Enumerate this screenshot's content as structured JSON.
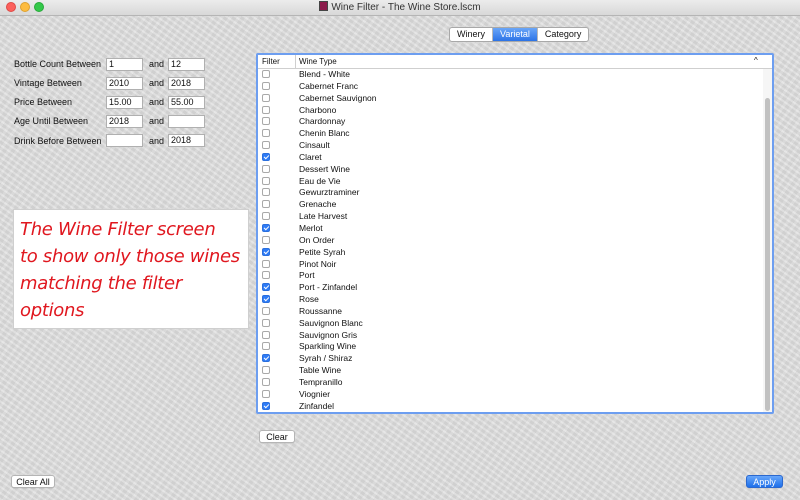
{
  "window": {
    "title": "Wine Filter - The Wine Store.lscm",
    "icons": {
      "close": "close-dot",
      "minimize": "minimize-dot",
      "zoom": "zoom-dot",
      "document": "document-icon"
    }
  },
  "tabs": [
    {
      "label": "Winery",
      "active": false
    },
    {
      "label": "Varietal",
      "active": true
    },
    {
      "label": "Category",
      "active": false
    }
  ],
  "filters": {
    "and_label": "and",
    "rows": [
      {
        "label": "Bottle Count Between",
        "from": "1",
        "to": "12"
      },
      {
        "label": "Vintage Between",
        "from": "2010",
        "to": "2018"
      },
      {
        "label": "Price Between",
        "from": "15.00",
        "to": "55.00"
      },
      {
        "label": "Age Until Between",
        "from": "2018",
        "to": ""
      },
      {
        "label": "Drink Before Between",
        "from": "",
        "to": "2018"
      }
    ]
  },
  "annotation": {
    "lines": [
      "The Wine Filter screen",
      "to show only those wines",
      "matching the filter",
      "options"
    ],
    "color": "#e0171f"
  },
  "table": {
    "columns": {
      "filter": "Filter",
      "wine_type": "Wine Type"
    },
    "sort_indicator": "^",
    "rows": [
      {
        "name": "Blend - White",
        "checked": false
      },
      {
        "name": "Cabernet Franc",
        "checked": false
      },
      {
        "name": "Cabernet Sauvignon",
        "checked": false
      },
      {
        "name": "Charbono",
        "checked": false
      },
      {
        "name": "Chardonnay",
        "checked": false
      },
      {
        "name": "Chenin Blanc",
        "checked": false
      },
      {
        "name": "Cinsault",
        "checked": false
      },
      {
        "name": "Claret",
        "checked": true
      },
      {
        "name": "Dessert Wine",
        "checked": false
      },
      {
        "name": "Eau de Vie",
        "checked": false
      },
      {
        "name": "Gewurztraminer",
        "checked": false
      },
      {
        "name": "Grenache",
        "checked": false
      },
      {
        "name": "Late Harvest",
        "checked": false
      },
      {
        "name": "Merlot",
        "checked": true
      },
      {
        "name": "On Order",
        "checked": false
      },
      {
        "name": "Petite Syrah",
        "checked": true
      },
      {
        "name": "Pinot Noir",
        "checked": false
      },
      {
        "name": "Port",
        "checked": false
      },
      {
        "name": "Port - Zinfandel",
        "checked": true
      },
      {
        "name": "Rose",
        "checked": true
      },
      {
        "name": "Roussanne",
        "checked": false
      },
      {
        "name": "Sauvignon Blanc",
        "checked": false
      },
      {
        "name": "Sauvignon Gris",
        "checked": false
      },
      {
        "name": "Sparkling Wine",
        "checked": false
      },
      {
        "name": "Syrah / Shiraz",
        "checked": true
      },
      {
        "name": "Table Wine",
        "checked": false
      },
      {
        "name": "Tempranillo",
        "checked": false
      },
      {
        "name": "Viognier",
        "checked": false
      },
      {
        "name": "Zinfandel",
        "checked": true
      }
    ]
  },
  "buttons": {
    "clear": "Clear",
    "clear_all": "Clear All",
    "apply": "Apply"
  },
  "colors": {
    "accent": "#2f7cf6",
    "focus_ring": "#6d9ef0"
  }
}
